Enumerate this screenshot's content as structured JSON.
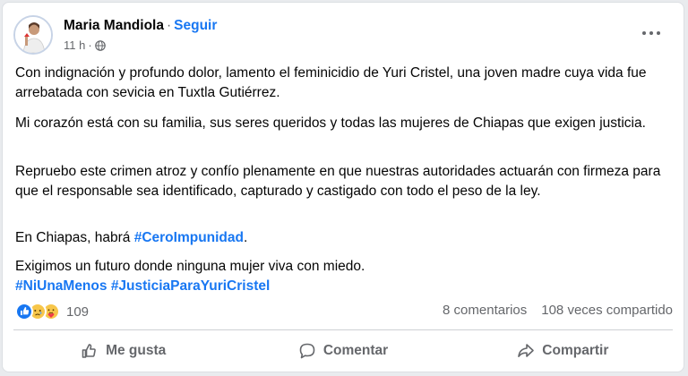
{
  "post": {
    "author": "Maria Mandiola",
    "separator": "·",
    "follow_label": "Seguir",
    "time": "11 h",
    "more_icon": "more-horizontal-icon",
    "audience_icon": "globe-icon"
  },
  "content": {
    "p1": "Con indignación y profundo dolor, lamento el feminicidio de Yuri Cristel, una joven madre cuya vida fue arrebatada con sevicia en Tuxtla Gutiérrez.",
    "p2": "Mi corazón está con su familia, sus seres queridos y todas las mujeres de Chiapas que exigen justicia.",
    "p3": "Repruebo este crimen atroz y confío plenamente en que nuestras autoridades actuarán con firmeza para que el responsable sea identificado, capturado y castigado con todo el peso de la ley.",
    "p4_text": "En Chiapas, habrá ",
    "p4_hashtag": "#CeroImpunidad",
    "p4_end": ".",
    "p5": "Exigimos un futuro donde ninguna mujer viva con miedo.",
    "hashtag1": "#NiUnaMenos",
    "hashtag2": "#JusticiaParaYuriCristel"
  },
  "stats": {
    "reaction_icons": [
      "like-reaction-icon",
      "sad-reaction-icon",
      "care-reaction-icon"
    ],
    "reactions_count": "109",
    "comments": "8 comentarios",
    "shares": "108 veces compartido"
  },
  "actions": {
    "like": "Me gusta",
    "comment": "Comentar",
    "share": "Compartir"
  },
  "colors": {
    "link": "#1877f2",
    "secondary": "#65676b"
  }
}
